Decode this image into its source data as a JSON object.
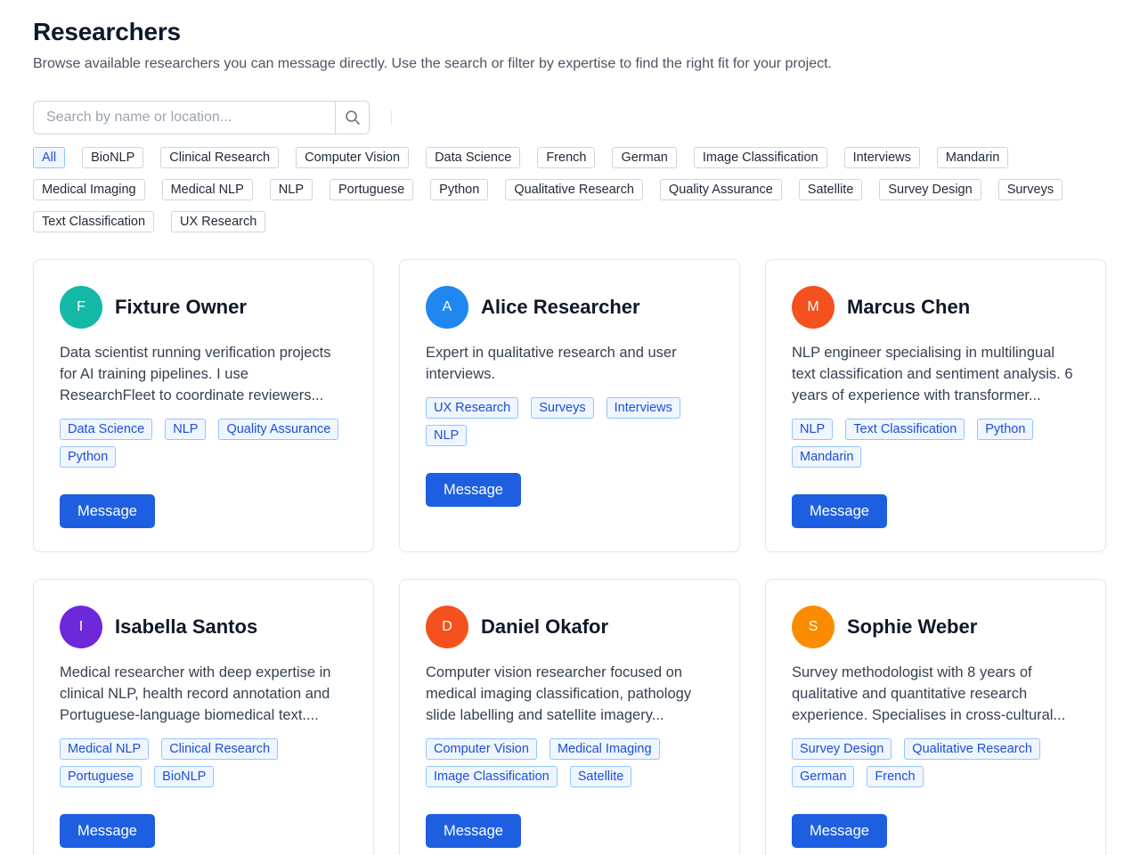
{
  "page": {
    "title": "Researchers",
    "subtitle": "Browse available researchers you can message directly. Use the search or filter by expertise to find the right fit for your project."
  },
  "search": {
    "placeholder": "Search by name or location...",
    "value": "",
    "icon": "search-icon"
  },
  "filters": [
    {
      "label": "All",
      "active": true
    },
    {
      "label": "BioNLP",
      "active": false
    },
    {
      "label": "Clinical Research",
      "active": false
    },
    {
      "label": "Computer Vision",
      "active": false
    },
    {
      "label": "Data Science",
      "active": false
    },
    {
      "label": "French",
      "active": false
    },
    {
      "label": "German",
      "active": false
    },
    {
      "label": "Image Classification",
      "active": false
    },
    {
      "label": "Interviews",
      "active": false
    },
    {
      "label": "Mandarin",
      "active": false
    },
    {
      "label": "Medical Imaging",
      "active": false
    },
    {
      "label": "Medical NLP",
      "active": false
    },
    {
      "label": "NLP",
      "active": false
    },
    {
      "label": "Portuguese",
      "active": false
    },
    {
      "label": "Python",
      "active": false
    },
    {
      "label": "Qualitative Research",
      "active": false
    },
    {
      "label": "Quality Assurance",
      "active": false
    },
    {
      "label": "Satellite",
      "active": false
    },
    {
      "label": "Survey Design",
      "active": false
    },
    {
      "label": "Surveys",
      "active": false
    },
    {
      "label": "Text Classification",
      "active": false
    },
    {
      "label": "UX Research",
      "active": false
    }
  ],
  "researchers": [
    {
      "initial": "F",
      "name": "Fixture Owner",
      "avatar_color": "#14b8a6",
      "bio": "Data scientist running verification projects for AI training pipelines. I use ResearchFleet to coordinate reviewers...",
      "tags": [
        "Data Science",
        "NLP",
        "Quality Assurance",
        "Python"
      ],
      "button": "Message"
    },
    {
      "initial": "A",
      "name": "Alice Researcher",
      "avatar_color": "#1e88f0",
      "bio": "Expert in qualitative research and user interviews.",
      "tags": [
        "UX Research",
        "Surveys",
        "Interviews",
        "NLP"
      ],
      "button": "Message"
    },
    {
      "initial": "M",
      "name": "Marcus Chen",
      "avatar_color": "#f4511e",
      "bio": "NLP engineer specialising in multilingual text classification and sentiment analysis. 6 years of experience with transformer...",
      "tags": [
        "NLP",
        "Text Classification",
        "Python",
        "Mandarin"
      ],
      "button": "Message"
    },
    {
      "initial": "I",
      "name": "Isabella Santos",
      "avatar_color": "#6d28d9",
      "bio": "Medical researcher with deep expertise in clinical NLP, health record annotation and Portuguese-language biomedical text....",
      "tags": [
        "Medical NLP",
        "Clinical Research",
        "Portuguese",
        "BioNLP"
      ],
      "button": "Message"
    },
    {
      "initial": "D",
      "name": "Daniel Okafor",
      "avatar_color": "#f4511e",
      "bio": "Computer vision researcher focused on medical imaging classification, pathology slide labelling and satellite imagery...",
      "tags": [
        "Computer Vision",
        "Medical Imaging",
        "Image Classification",
        "Satellite"
      ],
      "button": "Message"
    },
    {
      "initial": "S",
      "name": "Sophie Weber",
      "avatar_color": "#fb8c00",
      "bio": "Survey methodologist with 8 years of qualitative and quantitative research experience. Specialises in cross-cultural...",
      "tags": [
        "Survey Design",
        "Qualitative Research",
        "German",
        "French"
      ],
      "button": "Message"
    }
  ]
}
